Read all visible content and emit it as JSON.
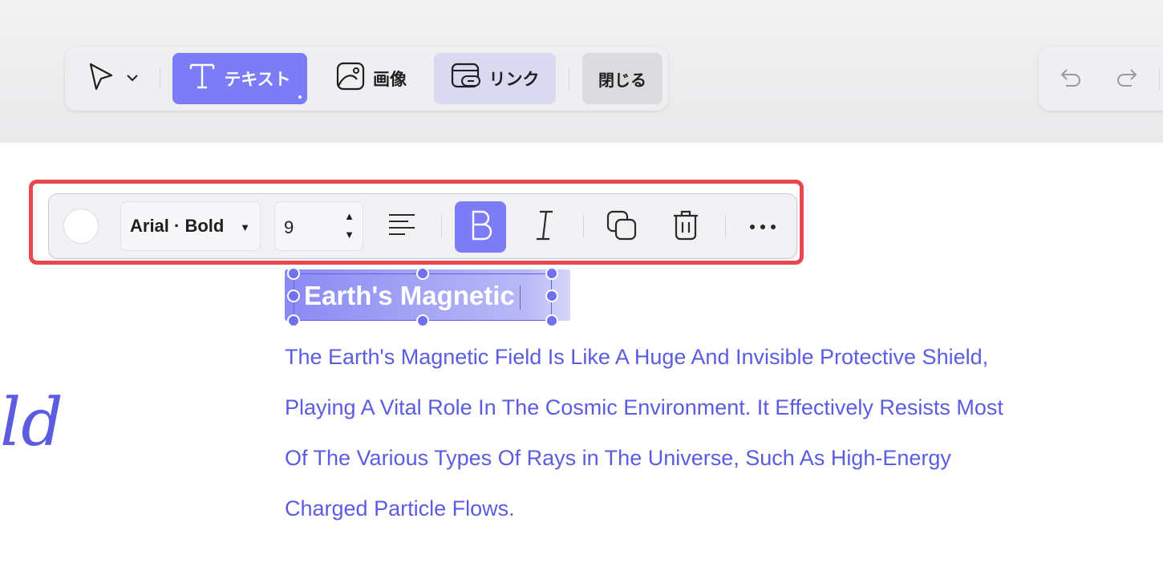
{
  "toolbar": {
    "text_label": "テキスト",
    "image_label": "画像",
    "link_label": "リンク",
    "close_label": "閉じる"
  },
  "format_toolbar": {
    "font": "Arial · Bold",
    "size": "9",
    "color": "#ffffff"
  },
  "selection": {
    "text": "Earth's Magnetic"
  },
  "body": {
    "lines": [
      "The Earth's Magnetic Field Is Like A Huge And Invisible Protective Shield,",
      "Playing A Vital Role In The Cosmic Environment. It Effectively Resists Most",
      "Of The Various Types Of Rays in The Universe, Such As High-Energy",
      "Charged Particle Flows."
    ]
  },
  "left_fragment": "ld",
  "colors": {
    "accent": "#7b7cf6",
    "text_blue": "#5b5ce0",
    "highlight_red": "#e5484d"
  },
  "icons": [
    "cursor-arrow-icon",
    "chevron-down-icon",
    "text-t-icon",
    "image-icon",
    "link-icon",
    "undo-icon",
    "redo-icon",
    "align-left-icon",
    "bold-icon",
    "italic-icon",
    "duplicate-icon",
    "trash-icon",
    "more-horizontal-icon"
  ]
}
